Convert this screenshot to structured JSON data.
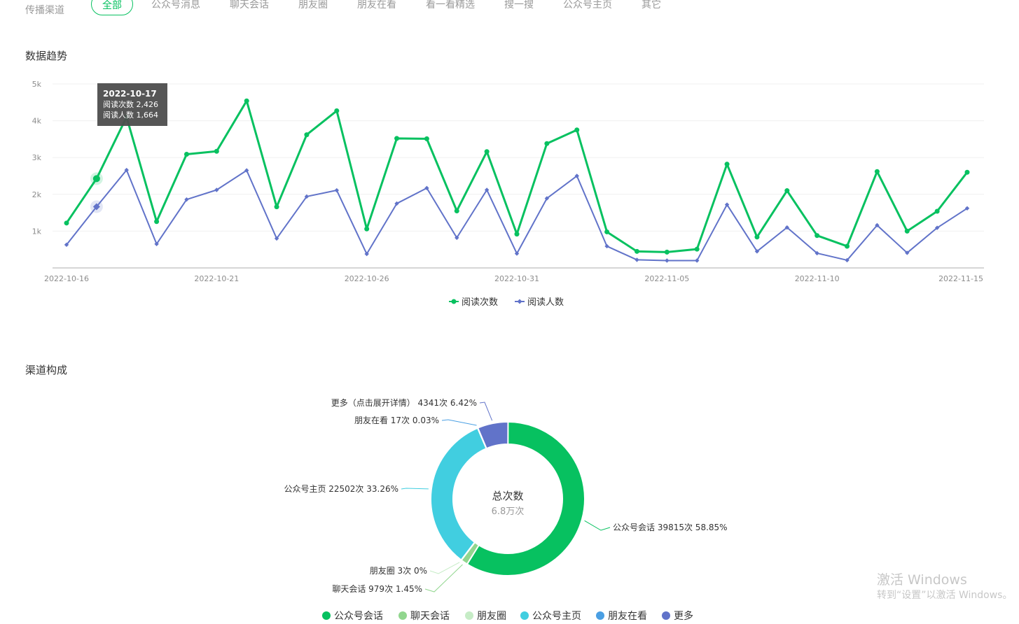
{
  "filter": {
    "label": "传播渠道",
    "options": [
      "全部",
      "公众号消息",
      "聊天会话",
      "朋友圈",
      "朋友在看",
      "看一看精选",
      "搜一搜",
      "公众号主页",
      "其它"
    ],
    "active": "全部"
  },
  "trend": {
    "title": "数据趋势"
  },
  "tooltip": {
    "date": "2022-10-17",
    "line1": "阅读次数 2,426",
    "line2": "阅读人数 1,664"
  },
  "composition": {
    "title": "渠道构成",
    "center_title": "总次数",
    "center_value": "6.8万次"
  },
  "watermark": {
    "line1": "激活 Windows",
    "line2": "转到“设置”以激活 Windows。"
  },
  "colors": {
    "accent": "#07c160",
    "series2": "#6173c9"
  },
  "chart_data": [
    {
      "type": "line",
      "x_ticks": [
        "2022-10-16",
        "2022-10-21",
        "2022-10-26",
        "2022-10-31",
        "2022-11-05",
        "2022-11-10",
        "2022-11-15"
      ],
      "y_ticks": [
        "1k",
        "2k",
        "3k",
        "4k",
        "5k"
      ],
      "ylim": [
        0,
        5000
      ],
      "grid": true,
      "legend_position": "bottom",
      "x": [
        "2022-10-16",
        "2022-10-17",
        "2022-10-18",
        "2022-10-19",
        "2022-10-20",
        "2022-10-21",
        "2022-10-22",
        "2022-10-23",
        "2022-10-24",
        "2022-10-25",
        "2022-10-26",
        "2022-10-27",
        "2022-10-28",
        "2022-10-29",
        "2022-10-30",
        "2022-10-31",
        "2022-11-01",
        "2022-11-02",
        "2022-11-03",
        "2022-11-04",
        "2022-11-05",
        "2022-11-06",
        "2022-11-07",
        "2022-11-08",
        "2022-11-09",
        "2022-11-10",
        "2022-11-11",
        "2022-11-12",
        "2022-11-13",
        "2022-11-14",
        "2022-11-15"
      ],
      "series": [
        {
          "name": "阅读次数",
          "color": "#07c160",
          "values": [
            1220,
            2426,
            4100,
            1260,
            3090,
            3170,
            4540,
            1660,
            3620,
            4270,
            1060,
            3520,
            3510,
            1550,
            3160,
            920,
            3380,
            3750,
            980,
            450,
            430,
            510,
            2820,
            840,
            2100,
            880,
            590,
            2620,
            1000,
            1540,
            2600
          ]
        },
        {
          "name": "阅读人数",
          "color": "#6173c9",
          "values": [
            630,
            1664,
            2660,
            650,
            1860,
            2120,
            2650,
            800,
            1940,
            2110,
            380,
            1750,
            2170,
            820,
            2120,
            390,
            1890,
            2500,
            590,
            220,
            200,
            200,
            1720,
            450,
            1100,
            400,
            210,
            1160,
            410,
            1090,
            1620
          ]
        }
      ]
    },
    {
      "type": "pie",
      "donut": true,
      "total_label": "6.8万次",
      "slices": [
        {
          "name": "公众号会话",
          "count": 39815,
          "percent": 58.85,
          "color": "#07c160",
          "label": "公众号会话 39815次 58.85%"
        },
        {
          "name": "聊天会话",
          "count": 979,
          "percent": 1.45,
          "color": "#91d68e",
          "label": "聊天会话 979次 1.45%"
        },
        {
          "name": "朋友圈",
          "count": 3,
          "percent": 0,
          "color": "#c6ecc6",
          "label": "朋友圈 3次 0%"
        },
        {
          "name": "公众号主页",
          "count": 22502,
          "percent": 33.26,
          "color": "#41cee0",
          "label": "公众号主页 22502次 33.26%"
        },
        {
          "name": "朋友在看",
          "count": 17,
          "percent": 0.03,
          "color": "#4a9fe3",
          "label": "朋友在看 17次 0.03%"
        },
        {
          "name": "更多",
          "count": 4341,
          "percent": 6.42,
          "color": "#6173c9",
          "label": "更多（点击展开详情） 4341次 6.42%"
        }
      ],
      "legend": [
        "公众号会话",
        "聊天会话",
        "朋友圈",
        "公众号主页",
        "朋友在看",
        "更多"
      ]
    }
  ]
}
